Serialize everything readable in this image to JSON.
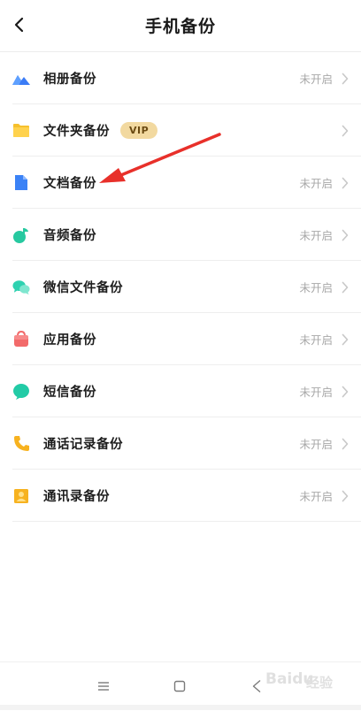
{
  "header": {
    "title": "手机备份",
    "back_icon": "chevron-left-icon"
  },
  "items": [
    {
      "label": "相册备份",
      "status": "未开启",
      "icon": "mountain-icon",
      "color": "#3b7cf6"
    },
    {
      "label": "文件夹备份",
      "badge": "VIP",
      "status": "",
      "icon": "folder-icon",
      "color": "#f6c02d"
    },
    {
      "label": "文档备份",
      "status": "未开启",
      "icon": "document-icon",
      "color": "#3b82f6"
    },
    {
      "label": "音频备份",
      "status": "未开启",
      "icon": "music-note-icon",
      "color": "#27c9a0"
    },
    {
      "label": "微信文件备份",
      "status": "未开启",
      "icon": "wechat-icon",
      "color": "#2ed1b0"
    },
    {
      "label": "应用备份",
      "status": "未开启",
      "icon": "bag-icon",
      "color": "#f26a6a"
    },
    {
      "label": "短信备份",
      "status": "未开启",
      "icon": "chat-bubble-icon",
      "color": "#22cba6"
    },
    {
      "label": "通话记录备份",
      "status": "未开启",
      "icon": "phone-icon",
      "color": "#f7b21f"
    },
    {
      "label": "通讯录备份",
      "status": "未开启",
      "icon": "contact-card-icon",
      "color": "#f7b21f"
    }
  ],
  "navbar": {
    "menu_icon": "menu-icon",
    "home_icon": "square-icon",
    "back_icon": "triangle-back-icon"
  },
  "watermark": {
    "text": "Baidu",
    "sub": "经验"
  },
  "annotation": {
    "arrow_color": "#e8302a"
  }
}
